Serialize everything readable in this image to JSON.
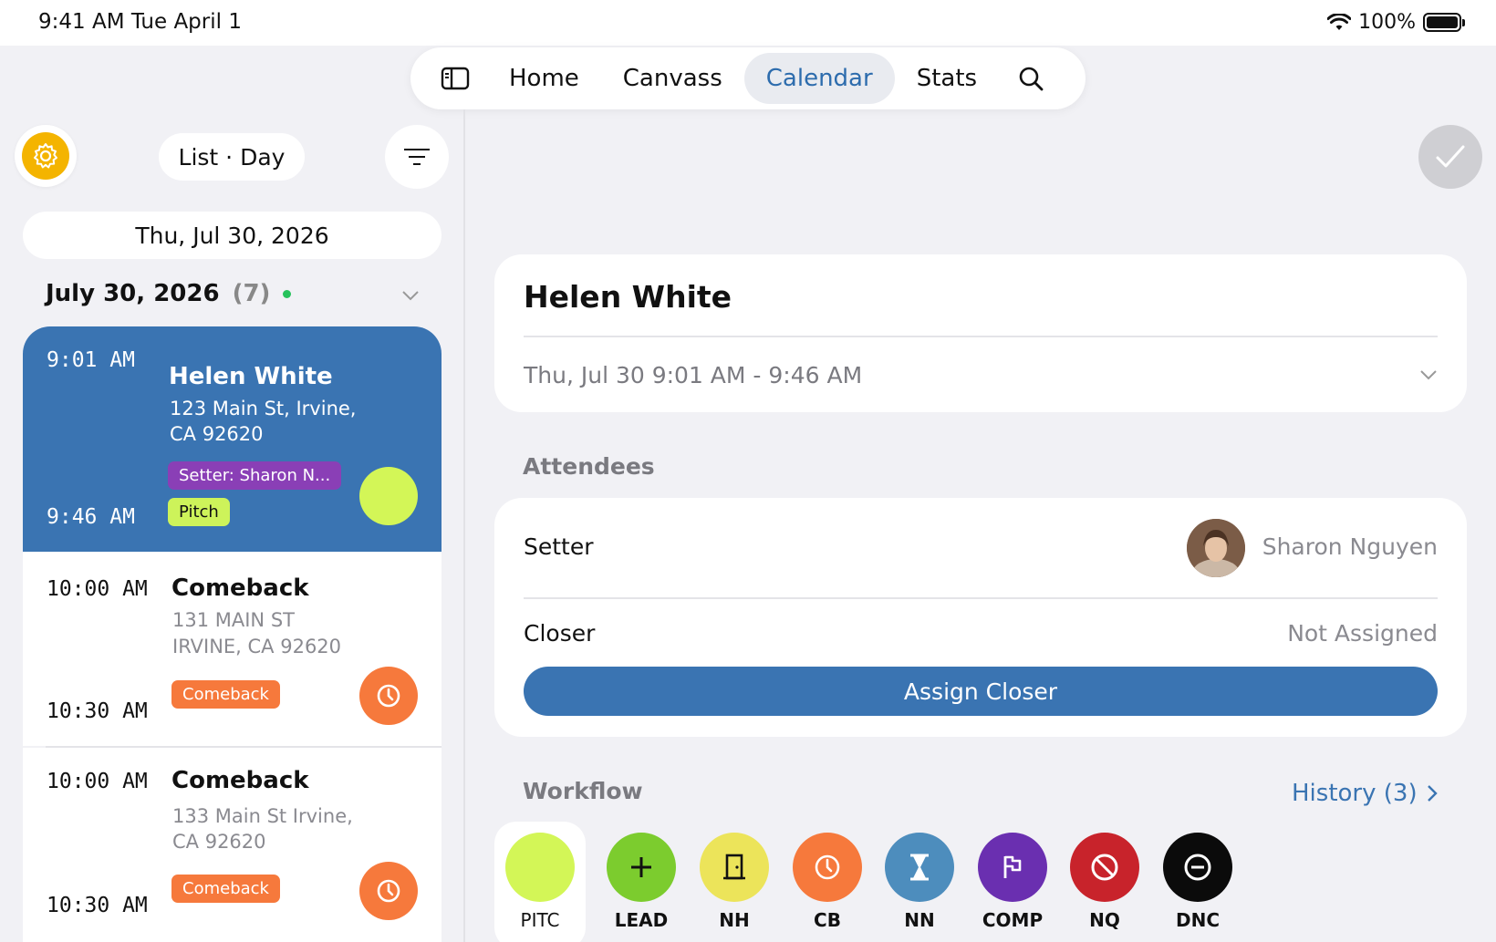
{
  "status_bar": {
    "time": "9:41 AM   Tue April 1",
    "battery": "100%"
  },
  "nav": {
    "tabs": [
      {
        "label": "Home"
      },
      {
        "label": "Canvass"
      },
      {
        "label": "Calendar"
      },
      {
        "label": "Stats"
      }
    ],
    "active_tab": "Calendar"
  },
  "left": {
    "view_label": "List · Day",
    "date_picker": "Thu, Jul 30, 2026",
    "day_title": "July 30, 2026",
    "day_count": "(7)",
    "appointments": [
      {
        "start": "9:01 AM",
        "end": "9:46 AM",
        "name": "Helen White",
        "address_1": "123 Main St, Irvine,",
        "address_2": "CA 92620",
        "setter_tag": "Setter: Sharon N...",
        "status_tag": "Pitch",
        "status_color": "#d3f657"
      },
      {
        "start": "10:00 AM",
        "end": "10:30 AM",
        "name": "Comeback",
        "address_1": "131 MAIN ST",
        "address_2": "IRVINE, CA 92620",
        "status_tag": "Comeback",
        "status_color": "#f6793c"
      },
      {
        "start": "10:00 AM",
        "end": "10:30 AM",
        "name": "Comeback",
        "address_1": "133 Main St Irvine,",
        "address_2": "CA 92620",
        "status_tag": "Comeback",
        "status_color": "#f6793c"
      }
    ]
  },
  "detail": {
    "name": "Helen White",
    "time_range": "Thu, Jul 30 9:01 AM - 9:46 AM",
    "attendees_label": "Attendees",
    "setter_label": "Setter",
    "setter_value": "Sharon Nguyen",
    "closer_label": "Closer",
    "closer_value": "Not Assigned",
    "assign_button": "Assign Closer",
    "workflow_label": "Workflow",
    "history_link": "History (3)",
    "workflow": [
      {
        "label": "PITC",
        "color": "#d3f657",
        "icon": "none"
      },
      {
        "label": "LEAD",
        "color": "#7ccc2e",
        "icon": "plus-icon"
      },
      {
        "label": "NH",
        "color": "#ece45a",
        "icon": "door-icon"
      },
      {
        "label": "CB",
        "color": "#f6793c",
        "icon": "clock-icon"
      },
      {
        "label": "NN",
        "color": "#4d8dbd",
        "icon": "hourglass-icon"
      },
      {
        "label": "COMP",
        "color": "#6a2fb0",
        "icon": "flag-icon"
      },
      {
        "label": "NQ",
        "color": "#c8232b",
        "icon": "ban-icon"
      },
      {
        "label": "DNC",
        "color": "#0b0b0b",
        "icon": "minus-circle-icon"
      }
    ]
  },
  "colors": {
    "accent": "#3a74b2",
    "background": "#f1f1f5"
  }
}
